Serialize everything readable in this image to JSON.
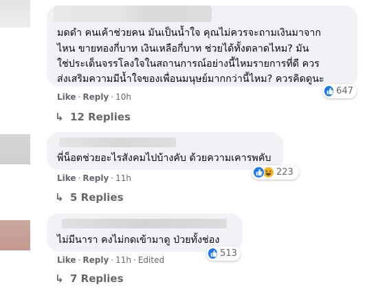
{
  "comments": [
    {
      "lines": [
        "มดดำ คนเค้าช่วยคน มันเป็นน้ำใจ คุณไม่ควรจะถามเงินมาจาก",
        "ไหน ขายทองกี่บาท เงินเหลือกี่บาท ช่วยได้ทั้งตลาดไหม? มัน",
        "ใช่ประเด็นจรรโลงใจในสถานการณ์อย่างนี้ไหมรายการที่ดี ควร",
        "ส่งเสริมความมีน้ำใจของเพื่อนมนุษย์มากกว่านี้ไหม? ควรคิดดูนะ"
      ],
      "like": "Like",
      "reply": "Reply",
      "time": "10h",
      "edited": "",
      "reaction_count": "647",
      "reactions": [
        "like-icon"
      ],
      "replies": "12 Replies"
    },
    {
      "lines": [
        "พี่น็อตช่วยอะไรสังคมไปบ้างคับ ด้วยความเคารพคับ"
      ],
      "like": "Like",
      "reply": "Reply",
      "time": "11h",
      "edited": "",
      "reaction_count": "223",
      "reactions": [
        "like-icon",
        "haha-icon"
      ],
      "replies": "5 Replies"
    },
    {
      "lines": [
        "ไม่มีนารา คงไม่กดเข้ามาดู ป่วยทั้งช่อง"
      ],
      "like": "Like",
      "reply": "Reply",
      "time": "11h",
      "edited": "Edited",
      "reaction_count": "513",
      "reactions": [
        "like-icon"
      ],
      "replies": "7 Replies"
    }
  ],
  "separator": "·",
  "reply_arrow": "↳",
  "colors": {
    "like_blue": "#1877f2",
    "haha_yellow": "#f7b125",
    "muted": "#65676b",
    "bubble": "#f0f2f5"
  }
}
